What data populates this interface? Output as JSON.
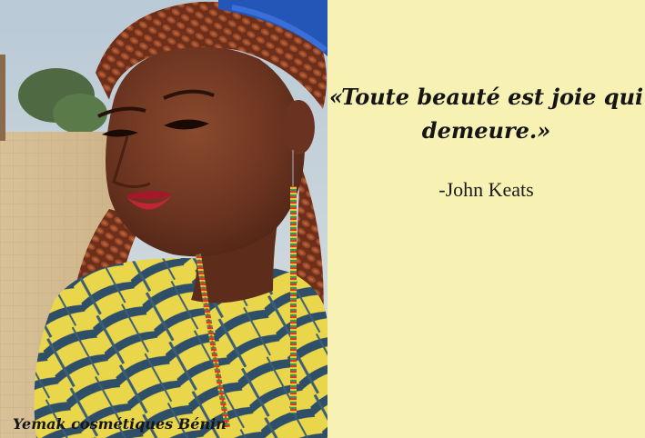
{
  "photo": {
    "subject": "woman-portrait-photo"
  },
  "watermark": {
    "text": "Yemak cosmétiques Bénin"
  },
  "quote": {
    "text_line1": "«Toute beauté est joie qui",
    "text_line2": "demeure.»",
    "author": "-John Keats"
  },
  "colors": {
    "background": "#f7f1b3",
    "text": "#151515"
  }
}
